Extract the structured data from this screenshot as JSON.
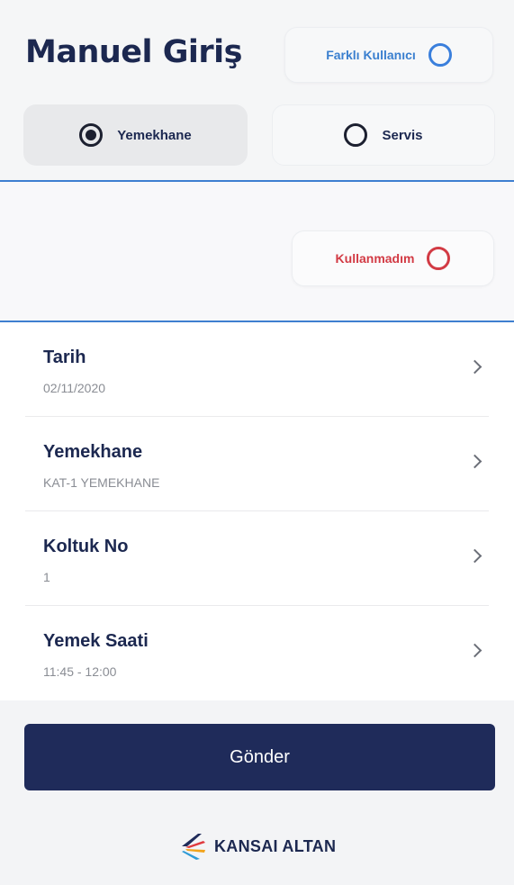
{
  "header": {
    "title": "Manuel Giriş",
    "other_user_label": "Farklı Kullanıcı"
  },
  "type_selector": {
    "options": [
      {
        "label": "Yemekhane",
        "selected": true
      },
      {
        "label": "Servis",
        "selected": false
      }
    ]
  },
  "not_used": {
    "label": "Kullanmadım"
  },
  "fields": [
    {
      "label": "Tarih",
      "value": "02/11/2020"
    },
    {
      "label": "Yemekhane",
      "value": "KAT-1 YEMEKHANE"
    },
    {
      "label": "Koltuk No",
      "value": "1"
    },
    {
      "label": "Yemek Saati",
      "value": "11:45 - 12:00"
    }
  ],
  "submit": {
    "label": "Gönder"
  },
  "brand": {
    "name": "KANSAI ALTAN"
  },
  "colors": {
    "primary": "#1f2b5a",
    "accent_blue": "#3a7fdc",
    "accent_red": "#d23a44"
  },
  "icons": {
    "other_user": "ring-blue-icon",
    "selected_radio": "radio-selected-icon",
    "unselected_radio": "radio-unselected-icon",
    "not_used": "ring-red-icon",
    "row_action": "chevron-right-icon"
  }
}
